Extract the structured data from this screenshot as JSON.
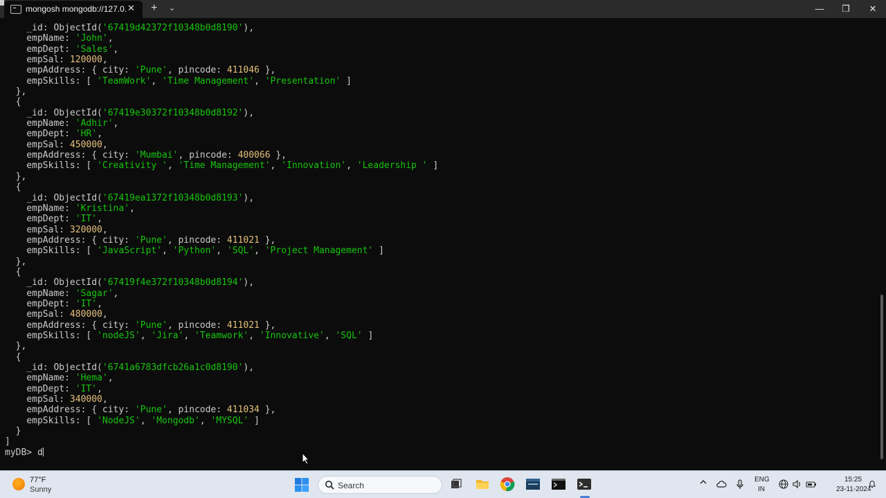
{
  "window": {
    "tab_title": "mongosh mongodb://127.0.0.",
    "tab_close": "✕",
    "new_tab": "+",
    "dropdown": "⌄",
    "minimize": "—",
    "maximize": "❐",
    "close": "✕"
  },
  "terminal": {
    "lines": [
      [
        {
          "t": "    _id: ObjectId("
        },
        {
          "t": "'67419d42372f10348b0d8190'",
          "c": "s"
        },
        {
          "t": "),"
        }
      ],
      [
        {
          "t": "    empName: "
        },
        {
          "t": "'John'",
          "c": "s"
        },
        {
          "t": ","
        }
      ],
      [
        {
          "t": "    empDept: "
        },
        {
          "t": "'Sales'",
          "c": "s"
        },
        {
          "t": ","
        }
      ],
      [
        {
          "t": "    empSal: "
        },
        {
          "t": "120000",
          "c": "n"
        },
        {
          "t": ","
        }
      ],
      [
        {
          "t": "    empAddress: { city: "
        },
        {
          "t": "'Pune'",
          "c": "s"
        },
        {
          "t": ", pincode: "
        },
        {
          "t": "411046",
          "c": "n"
        },
        {
          "t": " },"
        }
      ],
      [
        {
          "t": "    empSkills: [ "
        },
        {
          "t": "'TeamWork'",
          "c": "s"
        },
        {
          "t": ", "
        },
        {
          "t": "'Time Management'",
          "c": "s"
        },
        {
          "t": ", "
        },
        {
          "t": "'Presentation'",
          "c": "s"
        },
        {
          "t": " ]"
        }
      ],
      [
        {
          "t": "  },"
        }
      ],
      [
        {
          "t": "  {"
        }
      ],
      [
        {
          "t": "    _id: ObjectId("
        },
        {
          "t": "'67419e30372f10348b0d8192'",
          "c": "s"
        },
        {
          "t": "),"
        }
      ],
      [
        {
          "t": "    empName: "
        },
        {
          "t": "'Adhir'",
          "c": "s"
        },
        {
          "t": ","
        }
      ],
      [
        {
          "t": "    empDept: "
        },
        {
          "t": "'HR'",
          "c": "s"
        },
        {
          "t": ","
        }
      ],
      [
        {
          "t": "    empSal: "
        },
        {
          "t": "450000",
          "c": "n"
        },
        {
          "t": ","
        }
      ],
      [
        {
          "t": "    empAddress: { city: "
        },
        {
          "t": "'Mumbai'",
          "c": "s"
        },
        {
          "t": ", pincode: "
        },
        {
          "t": "400066",
          "c": "n"
        },
        {
          "t": " },"
        }
      ],
      [
        {
          "t": "    empSkills: [ "
        },
        {
          "t": "'Creativity '",
          "c": "s"
        },
        {
          "t": ", "
        },
        {
          "t": "'Time Management'",
          "c": "s"
        },
        {
          "t": ", "
        },
        {
          "t": "'Innovation'",
          "c": "s"
        },
        {
          "t": ", "
        },
        {
          "t": "'Leadership '",
          "c": "s"
        },
        {
          "t": " ]"
        }
      ],
      [
        {
          "t": "  },"
        }
      ],
      [
        {
          "t": "  {"
        }
      ],
      [
        {
          "t": "    _id: ObjectId("
        },
        {
          "t": "'67419ea1372f10348b0d8193'",
          "c": "s"
        },
        {
          "t": "),"
        }
      ],
      [
        {
          "t": "    empName: "
        },
        {
          "t": "'Kristina'",
          "c": "s"
        },
        {
          "t": ","
        }
      ],
      [
        {
          "t": "    empDept: "
        },
        {
          "t": "'IT'",
          "c": "s"
        },
        {
          "t": ","
        }
      ],
      [
        {
          "t": "    empSal: "
        },
        {
          "t": "320000",
          "c": "n"
        },
        {
          "t": ","
        }
      ],
      [
        {
          "t": "    empAddress: { city: "
        },
        {
          "t": "'Pune'",
          "c": "s"
        },
        {
          "t": ", pincode: "
        },
        {
          "t": "411021",
          "c": "n"
        },
        {
          "t": " },"
        }
      ],
      [
        {
          "t": "    empSkills: [ "
        },
        {
          "t": "'JavaScript'",
          "c": "s"
        },
        {
          "t": ", "
        },
        {
          "t": "'Python'",
          "c": "s"
        },
        {
          "t": ", "
        },
        {
          "t": "'SQL'",
          "c": "s"
        },
        {
          "t": ", "
        },
        {
          "t": "'Project Management'",
          "c": "s"
        },
        {
          "t": " ]"
        }
      ],
      [
        {
          "t": "  },"
        }
      ],
      [
        {
          "t": "  {"
        }
      ],
      [
        {
          "t": "    _id: ObjectId("
        },
        {
          "t": "'67419f4e372f10348b0d8194'",
          "c": "s"
        },
        {
          "t": "),"
        }
      ],
      [
        {
          "t": "    empName: "
        },
        {
          "t": "'Sagar'",
          "c": "s"
        },
        {
          "t": ","
        }
      ],
      [
        {
          "t": "    empDept: "
        },
        {
          "t": "'IT'",
          "c": "s"
        },
        {
          "t": ","
        }
      ],
      [
        {
          "t": "    empSal: "
        },
        {
          "t": "480000",
          "c": "n"
        },
        {
          "t": ","
        }
      ],
      [
        {
          "t": "    empAddress: { city: "
        },
        {
          "t": "'Pune'",
          "c": "s"
        },
        {
          "t": ", pincode: "
        },
        {
          "t": "411021",
          "c": "n"
        },
        {
          "t": " },"
        }
      ],
      [
        {
          "t": "    empSkills: [ "
        },
        {
          "t": "'nodeJS'",
          "c": "s"
        },
        {
          "t": ", "
        },
        {
          "t": "'Jira'",
          "c": "s"
        },
        {
          "t": ", "
        },
        {
          "t": "'Teamwork'",
          "c": "s"
        },
        {
          "t": ", "
        },
        {
          "t": "'Innovative'",
          "c": "s"
        },
        {
          "t": ", "
        },
        {
          "t": "'SQL'",
          "c": "s"
        },
        {
          "t": " ]"
        }
      ],
      [
        {
          "t": "  },"
        }
      ],
      [
        {
          "t": "  {"
        }
      ],
      [
        {
          "t": "    _id: ObjectId("
        },
        {
          "t": "'6741a6783dfcb26a1c0d8190'",
          "c": "s"
        },
        {
          "t": "),"
        }
      ],
      [
        {
          "t": "    empName: "
        },
        {
          "t": "'Hema'",
          "c": "s"
        },
        {
          "t": ","
        }
      ],
      [
        {
          "t": "    empDept: "
        },
        {
          "t": "'IT'",
          "c": "s"
        },
        {
          "t": ","
        }
      ],
      [
        {
          "t": "    empSal: "
        },
        {
          "t": "340000",
          "c": "n"
        },
        {
          "t": ","
        }
      ],
      [
        {
          "t": "    empAddress: { city: "
        },
        {
          "t": "'Pune'",
          "c": "s"
        },
        {
          "t": ", pincode: "
        },
        {
          "t": "411034",
          "c": "n"
        },
        {
          "t": " },"
        }
      ],
      [
        {
          "t": "    empSkills: [ "
        },
        {
          "t": "'NodeJS'",
          "c": "s"
        },
        {
          "t": ", "
        },
        {
          "t": "'Mongodb'",
          "c": "s"
        },
        {
          "t": ", "
        },
        {
          "t": "'MYSQL'",
          "c": "s"
        },
        {
          "t": " ]"
        }
      ],
      [
        {
          "t": "  }"
        }
      ],
      [
        {
          "t": "]"
        }
      ]
    ],
    "prompt": "myDB> ",
    "input": "d"
  },
  "taskbar": {
    "weather_temp": "77°F",
    "weather_desc": "Sunny",
    "search_label": "Search",
    "lang_1": "ENG",
    "lang_2": "IN",
    "time": "15:25",
    "date": "23-11-2024"
  },
  "colors": {
    "string": "#16c60c",
    "number": "#e5c07b",
    "terminal_bg": "#0c0c0c",
    "taskbar_bg": "#dfe6ef"
  }
}
